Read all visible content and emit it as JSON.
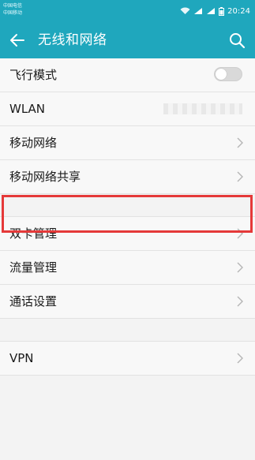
{
  "status_bar": {
    "carrier_1": "中国电信",
    "carrier_2": "中国移动",
    "time": "20:24"
  },
  "header": {
    "title": "无线和网络",
    "back_icon": "arrow-left-icon",
    "search_icon": "search-icon"
  },
  "settings": {
    "airplane_mode": {
      "label": "飞行模式",
      "enabled": false
    },
    "wlan": {
      "label": "WLAN"
    },
    "mobile_network": {
      "label": "移动网络"
    },
    "tethering": {
      "label": "移动网络共享"
    },
    "dual_sim": {
      "label": "双卡管理"
    },
    "data_usage": {
      "label": "流量管理"
    },
    "call_settings": {
      "label": "通话设置"
    },
    "vpn": {
      "label": "VPN"
    }
  },
  "colors": {
    "accent": "#1fa7bd",
    "highlight": "#e53939"
  }
}
